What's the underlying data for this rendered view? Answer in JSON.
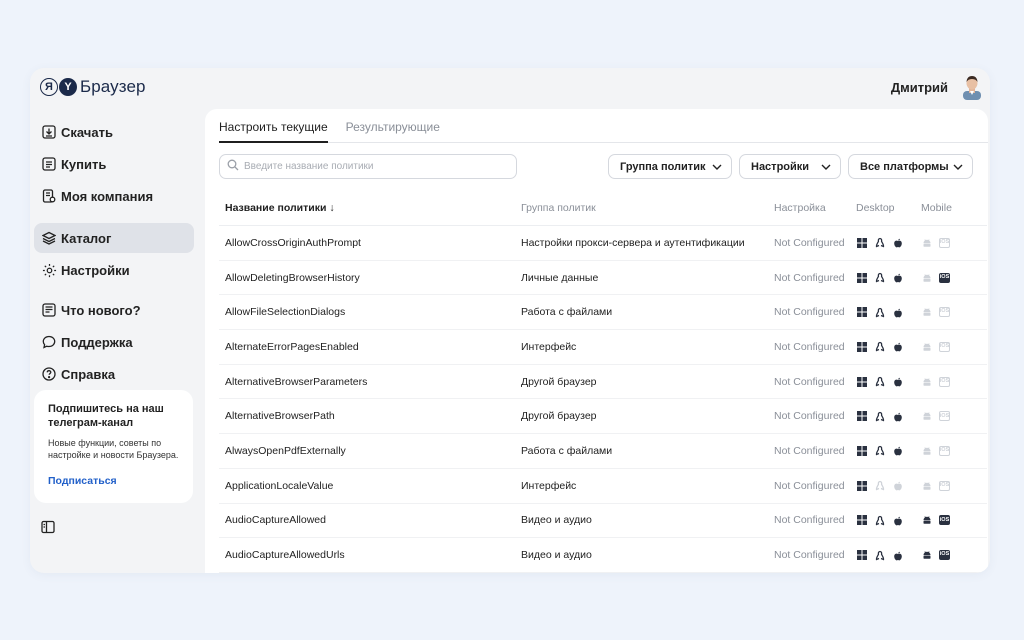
{
  "app": {
    "logo_mark_1": "Я",
    "logo_mark_2": "Y",
    "logo_text": "Браузер",
    "user_name": "Дмитрий"
  },
  "sidebar": {
    "items": [
      {
        "label": "Скачать",
        "icon": "download-icon"
      },
      {
        "label": "Купить",
        "icon": "cart-icon"
      },
      {
        "label": "Моя компания",
        "icon": "company-icon"
      },
      {
        "label": "Каталог",
        "icon": "layers-icon",
        "active": true
      },
      {
        "label": "Настройки",
        "icon": "gear-icon"
      },
      {
        "label": "Что нового?",
        "icon": "news-icon"
      },
      {
        "label": "Поддержка",
        "icon": "chat-icon"
      },
      {
        "label": "Справка",
        "icon": "help-icon"
      }
    ],
    "promo": {
      "title": "Подпишитесь на наш телеграм-канал",
      "text": "Новые функции, советы по настройке и новости Браузера.",
      "link": "Подписаться"
    }
  },
  "tabs": [
    {
      "label": "Настроить текущие",
      "active": true
    },
    {
      "label": "Результирующие",
      "active": false
    }
  ],
  "search": {
    "placeholder": "Введите название политики",
    "value": ""
  },
  "filters": {
    "group": "Группа политик",
    "setting": "Настройки",
    "platform": "Все платформы"
  },
  "table": {
    "headers": {
      "name": "Название политики",
      "sort_arrow": "↓",
      "group": "Группа политик",
      "setting": "Настройка",
      "desktop": "Desktop",
      "mobile": "Mobile"
    },
    "rows": [
      {
        "name": "AllowCrossOriginAuthPrompt",
        "group": "Настройки прокси-сервера и аутентификации",
        "setting": "Not Configured",
        "win": true,
        "linux": true,
        "mac": true,
        "android": false,
        "ios": false
      },
      {
        "name": "AllowDeletingBrowserHistory",
        "group": "Личные данные",
        "setting": "Not Configured",
        "win": true,
        "linux": true,
        "mac": true,
        "android": false,
        "ios": true
      },
      {
        "name": "AllowFileSelectionDialogs",
        "group": "Работа с файлами",
        "setting": "Not Configured",
        "win": true,
        "linux": true,
        "mac": true,
        "android": false,
        "ios": false
      },
      {
        "name": "AlternateErrorPagesEnabled",
        "group": "Интерфейс",
        "setting": "Not Configured",
        "win": true,
        "linux": true,
        "mac": true,
        "android": false,
        "ios": false
      },
      {
        "name": "AlternativeBrowserParameters",
        "group": "Другой браузер",
        "setting": "Not Configured",
        "win": true,
        "linux": true,
        "mac": true,
        "android": false,
        "ios": false
      },
      {
        "name": "AlternativeBrowserPath",
        "group": "Другой браузер",
        "setting": "Not Configured",
        "win": true,
        "linux": true,
        "mac": true,
        "android": false,
        "ios": false
      },
      {
        "name": "AlwaysOpenPdfExternally",
        "group": "Работа с файлами",
        "setting": "Not Configured",
        "win": true,
        "linux": true,
        "mac": true,
        "android": false,
        "ios": false
      },
      {
        "name": "ApplicationLocaleValue",
        "group": "Интерфейс",
        "setting": "Not Configured",
        "win": true,
        "linux": false,
        "mac": false,
        "android": false,
        "ios": false
      },
      {
        "name": "AudioCaptureAllowed",
        "group": "Видео и аудио",
        "setting": "Not Configured",
        "win": true,
        "linux": true,
        "mac": true,
        "android": true,
        "ios": true
      },
      {
        "name": "AudioCaptureAllowedUrls",
        "group": "Видео и аудио",
        "setting": "Not Configured",
        "win": true,
        "linux": true,
        "mac": true,
        "android": true,
        "ios": true
      }
    ]
  },
  "colors": {
    "background": "#eef3fb",
    "accent_link": "#2260c9",
    "icon_active": "#2a3140",
    "icon_inactive": "#cfd3d9"
  }
}
